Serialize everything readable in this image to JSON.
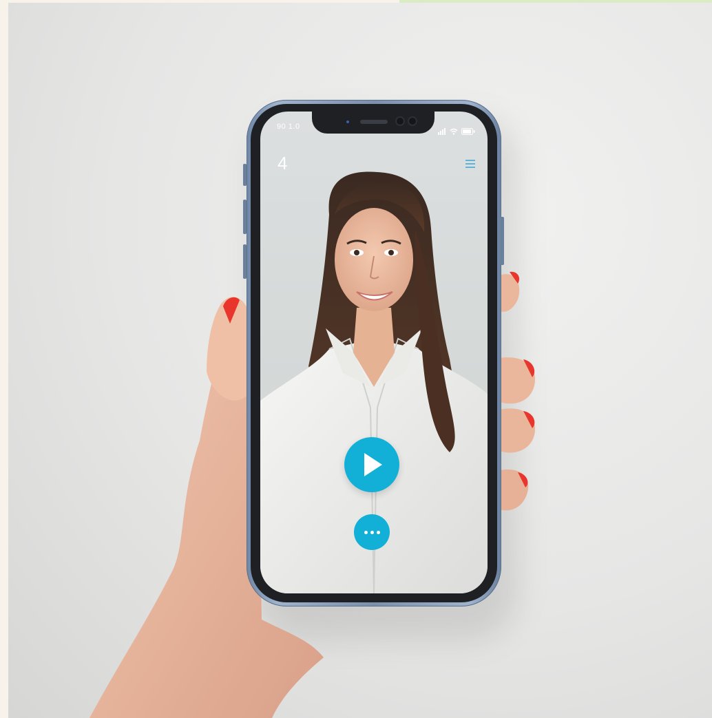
{
  "status_bar": {
    "time": "90 1.0"
  },
  "app_header": {
    "back_glyph": "4",
    "menu_icon": "hamburger-menu-icon"
  },
  "player": {
    "play_icon": "play-icon",
    "more_icon": "more-dots-icon"
  },
  "colors": {
    "accent": "#12b0d6",
    "menu_accent": "#5fb3d8",
    "phone_frame": "#7b90ad",
    "backdrop": "#e6e6e5"
  }
}
